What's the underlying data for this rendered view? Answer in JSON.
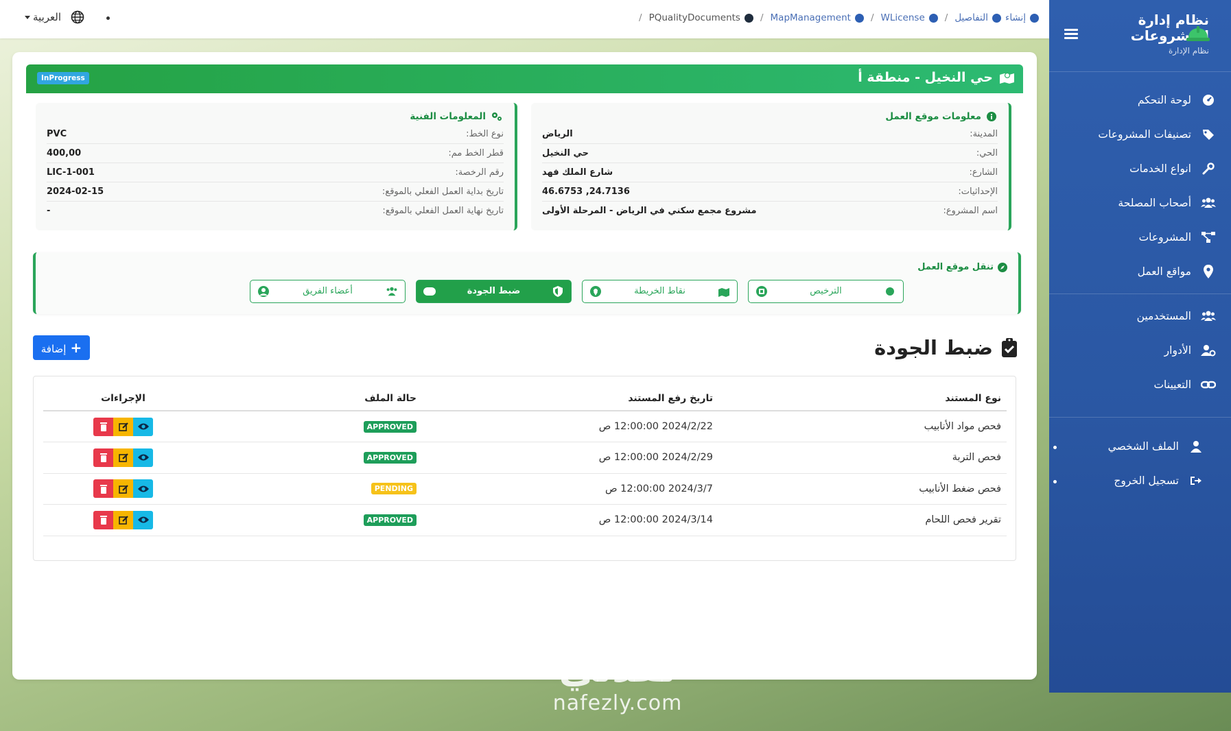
{
  "topbar": {
    "language_label": "العربية",
    "breadcrumb": [
      {
        "label": "إنشاء",
        "dot": "blue"
      },
      {
        "label": "التفاصيل",
        "dot": "blue"
      },
      {
        "label": "WLicense",
        "dot": "blue"
      },
      {
        "label": "MapManagement",
        "dot": "blue"
      },
      {
        "label": "PQualityDocuments",
        "dot": "dark"
      }
    ]
  },
  "sidebar": {
    "brand_title": "نظام إدارة المشروعات",
    "brand_subtitle": "نظام الإدارة",
    "items": [
      {
        "label": "لوحة التحكم",
        "icon": "dashboard-icon"
      },
      {
        "label": "تصنيفات المشروعات",
        "icon": "tag-icon"
      },
      {
        "label": "انواع الخدمات",
        "icon": "wrench-icon"
      },
      {
        "label": "أصحاب المصلحة",
        "icon": "users-icon"
      },
      {
        "label": "المشروعات",
        "icon": "project-diagram-icon"
      },
      {
        "label": "مواقع العمل",
        "icon": "map-pin-icon"
      },
      {
        "label": "المستخدمين",
        "icon": "users-icon"
      },
      {
        "label": "الأدوار",
        "icon": "user-cog-icon"
      },
      {
        "label": "التعيينات",
        "icon": "link-icon"
      }
    ],
    "footer_items": [
      {
        "label": "الملف الشخصي",
        "icon": "user-icon"
      },
      {
        "label": "تسجيل الخروج",
        "icon": "logout-icon"
      }
    ]
  },
  "header": {
    "title": "حي النخيل - منطقة أ",
    "status": "InProgress",
    "colors": {
      "bar_start": "#25a244",
      "bar_end": "#2dba72",
      "badge": "#31a6e0"
    }
  },
  "site_info": {
    "heading": "معلومات موقع العمل",
    "rows": [
      {
        "label": "المدينة:",
        "value": "الرياض"
      },
      {
        "label": "الحي:",
        "value": "حي النخيل"
      },
      {
        "label": "الشارع:",
        "value": "شارع الملك فهد"
      },
      {
        "label": "الإحداثيات:",
        "value": "24.7136, 46.6753"
      },
      {
        "label": "اسم المشروع:",
        "value": "مشروع مجمع سكني في الرياض - المرحلة الأولى"
      }
    ]
  },
  "tech_info": {
    "heading": "المعلومات الفنية",
    "rows": [
      {
        "label": "نوع الخط:",
        "value": "PVC"
      },
      {
        "label": "قطر الخط مم:",
        "value": "400,00"
      },
      {
        "label": "رقم الرخصة:",
        "value": "LIC-1-001"
      },
      {
        "label": "تاريخ بداية العمل الفعلي بالموقع:",
        "value": "2024-02-15"
      },
      {
        "label": "تاريخ نهاية العمل الفعلي بالموقع:",
        "value": "-"
      }
    ]
  },
  "site_nav": {
    "title": "تنقل موقع العمل",
    "buttons": [
      {
        "label": "الترخيص",
        "active": false
      },
      {
        "label": "نقاط الخريطة",
        "active": false
      },
      {
        "label": "ضبط الجودة",
        "active": true
      },
      {
        "label": "أعضاء الفريق",
        "active": false
      }
    ]
  },
  "section": {
    "title": "ضبط الجودة",
    "add_label": "إضافة"
  },
  "table": {
    "headers": {
      "type": "نوع المستند",
      "date": "تاريخ رفع المستند",
      "status": "حالة الملف",
      "actions": "الإجراءات"
    },
    "rows": [
      {
        "type": "فحص مواد الأنابيب",
        "date": "2024/2/22 12:00:00 ص",
        "status": "APPROVED"
      },
      {
        "type": "فحص التربة",
        "date": "2024/2/29 12:00:00 ص",
        "status": "APPROVED"
      },
      {
        "type": "فحص ضغط الأنابيب",
        "date": "2024/3/7 12:00:00 ص",
        "status": "PENDING"
      },
      {
        "type": "تقرير فحص اللحام",
        "date": "2024/3/14 12:00:00 ص",
        "status": "APPROVED"
      }
    ]
  },
  "watermark": {
    "arabic": "نفذلي",
    "latin": "nafezly.com"
  }
}
